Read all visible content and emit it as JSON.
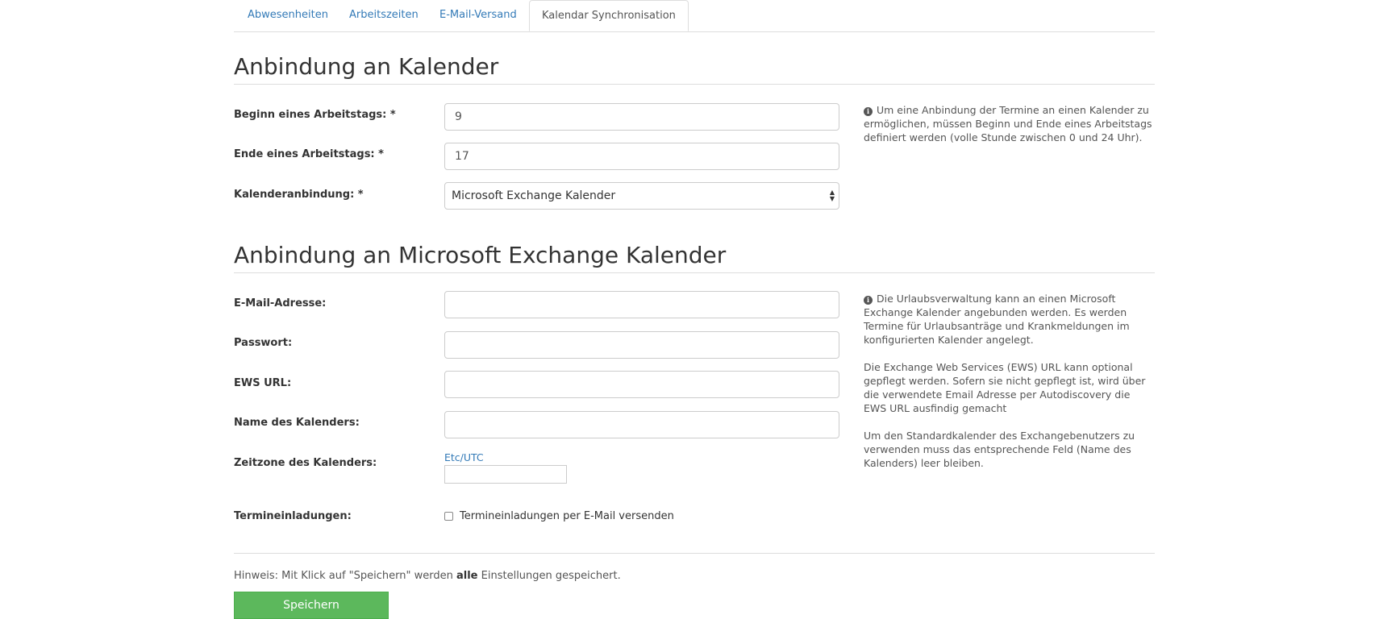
{
  "tabs": [
    {
      "label": "Abwesenheiten"
    },
    {
      "label": "Arbeitszeiten"
    },
    {
      "label": "E-Mail-Versand"
    },
    {
      "label": "Kalendar Synchronisation"
    }
  ],
  "section1": {
    "title": "Anbindung an Kalender",
    "fields": {
      "start": {
        "label": "Beginn eines Arbeitstags: *",
        "value": "9"
      },
      "end": {
        "label": "Ende eines Arbeitstags: *",
        "value": "17"
      },
      "connection": {
        "label": "Kalenderanbindung: *",
        "value": "Microsoft Exchange Kalender"
      }
    },
    "help": "Um eine Anbindung der Termine an einen Kalender zu ermöglichen, müssen Beginn und Ende eines Arbeitstags definiert werden (volle Stunde zwischen 0 und 24 Uhr)."
  },
  "section2": {
    "title": "Anbindung an Microsoft Exchange Kalender",
    "fields": {
      "email": {
        "label": "E-Mail-Adresse:",
        "value": ""
      },
      "password": {
        "label": "Passwort:",
        "value": ""
      },
      "ews": {
        "label": "EWS URL:",
        "value": ""
      },
      "calendar_name": {
        "label": "Name des Kalenders:",
        "value": ""
      },
      "timezone": {
        "label": "Zeitzone des Kalenders:",
        "value": "Etc/UTC"
      },
      "invites": {
        "label": "Termineinladungen:",
        "checkbox_label": "Termineinladungen per E-Mail versenden",
        "checked": false
      }
    },
    "help": [
      "Die Urlaubsverwaltung kann an einen Microsoft Exchange Kalender angebunden werden. Es werden Termine für Urlaubsanträge und Krankmeldungen im konfigurierten Kalender angelegt.",
      "Die Exchange Web Services (EWS) URL kann optional gepflegt werden. Sofern sie nicht gepflegt ist, wird über die verwendete Email Adresse per Autodiscovery die EWS URL ausfindig gemacht",
      "Um den Standardkalender des Exchangebenutzers zu verwenden muss das entsprechende Feld (Name des Kalenders) leer bleiben."
    ]
  },
  "footer": {
    "note_prefix": "Hinweis: Mit Klick auf \"Speichern\" werden ",
    "note_bold": "alle",
    "note_suffix": " Einstellungen gespeichert.",
    "save_label": "Speichern"
  }
}
